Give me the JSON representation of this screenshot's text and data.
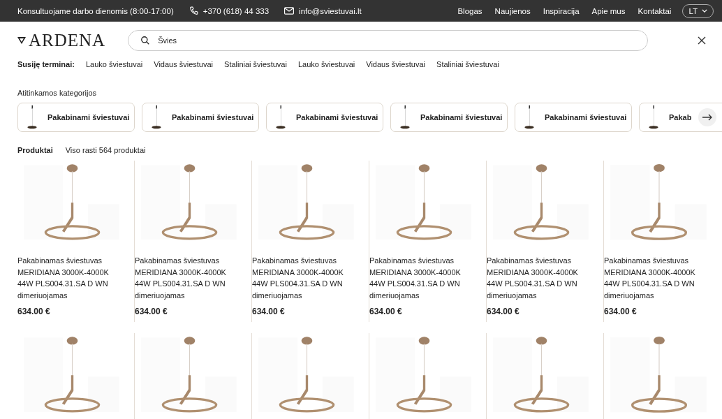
{
  "top_bar": {
    "hours": "Konsultuojame darbo dienomis (8:00-17:00)",
    "phone": "+370 (618) 44 333",
    "email": "info@sviestuvai.lt",
    "links": [
      "Blogas",
      "Naujienos",
      "Inspiracija",
      "Apie mus",
      "Kontaktai"
    ],
    "language": "LT"
  },
  "header": {
    "logo": "ARDENA",
    "search": {
      "value": "Švies"
    }
  },
  "related_terms": {
    "label": "Susiję terminai:",
    "terms": [
      "Lauko šviestuvai",
      "Vidaus šviestuvai",
      "Staliniai šviestuvai",
      "Lauko šviestuvai",
      "Vidaus šviestuvai",
      "Staliniai šviestuvai"
    ]
  },
  "categories": {
    "title": "Atitinkamos kategorijos",
    "items": [
      {
        "label": "Pakabinami šviestuvai"
      },
      {
        "label": "Pakabinami šviestuvai"
      },
      {
        "label": "Pakabinami šviestuvai"
      },
      {
        "label": "Pakabinami šviestuvai"
      },
      {
        "label": "Pakabinami šviestuvai"
      },
      {
        "label": "Pakab"
      }
    ]
  },
  "products": {
    "title": "Produktai",
    "count": "Viso rasti 564 produktai",
    "items": [
      {
        "kind": "product",
        "name": "Pakabinamas šviestuvas MERIDIANA 3000K-4000K 44W PLS004.31.SA D WN dimeriuojamas",
        "price": "634.00 €"
      },
      {
        "kind": "product",
        "name": "Pakabinamas šviestuvas MERIDIANA 3000K-4000K 44W PLS004.31.SA D WN dimeriuojamas",
        "price": "634.00 €"
      },
      {
        "kind": "product",
        "name": "Pakabinamas šviestuvas MERIDIANA 3000K-4000K 44W PLS004.31.SA D WN dimeriuojamas",
        "price": "634.00 €"
      },
      {
        "kind": "product",
        "name": "Pakabinamas šviestuvas MERIDIANA 3000K-4000K 44W PLS004.31.SA D WN dimeriuojamas",
        "price": "634.00 €"
      },
      {
        "kind": "product",
        "name": "Pakabinamas šviestuvas MERIDIANA 3000K-4000K 44W PLS004.31.SA D WN dimeriuojamas",
        "price": "634.00 €"
      },
      {
        "kind": "product",
        "name": "Pakabinamas šviestuvas MERIDIANA 3000K-4000K 44W PLS004.31.SA D WN dimeriuojamas",
        "price": "634.00 €"
      },
      {
        "kind": "picture"
      },
      {
        "kind": "picture"
      },
      {
        "kind": "picture"
      },
      {
        "kind": "picture"
      },
      {
        "kind": "picture"
      },
      {
        "kind": "picture"
      }
    ]
  }
}
